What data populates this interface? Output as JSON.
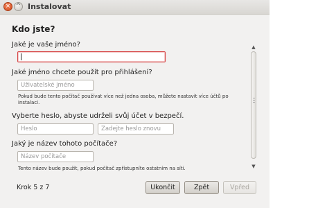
{
  "window": {
    "title": "Instalovat"
  },
  "page": {
    "heading": "Kdo jste?"
  },
  "name_section": {
    "label": "Jaké je vaše jméno?",
    "value": ""
  },
  "username_section": {
    "label": "Jaké jméno chcete použít pro přihlášení?",
    "placeholder": "Uživatelské jméno",
    "note": "Pokud bude tento počítač používat více než jedna osoba, můžete nastavit více účtů po instalaci."
  },
  "password_section": {
    "label": "Vyberte heslo, abyste udrželi svůj účet v bezpečí.",
    "password_placeholder": "Heslo",
    "confirm_placeholder": "Zadejte heslo znovu"
  },
  "computer_section": {
    "label": "Jaký je název tohoto počítače?",
    "placeholder": "Název počítače",
    "note": "Tento název bude použit, pokud počítač zpřístupníte ostatním na síti."
  },
  "footer": {
    "step": "Krok 5 z 7",
    "cancel_label": "Ukončit",
    "back_label": "Zpět",
    "forward_label": "Vpřed"
  }
}
